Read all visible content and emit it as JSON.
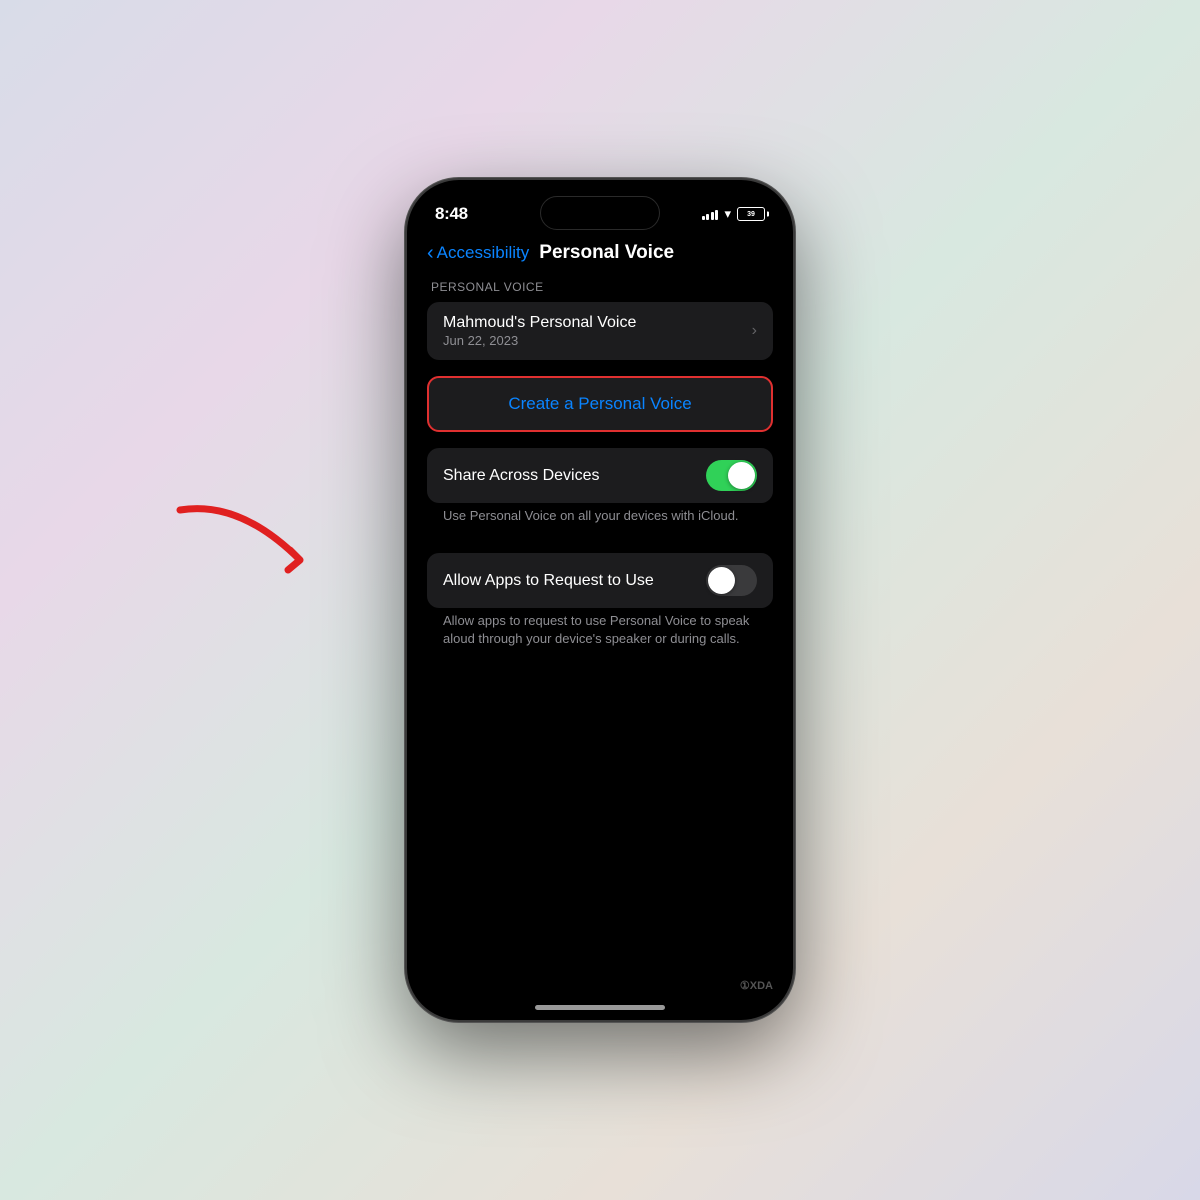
{
  "background": {
    "gradient": "linear-gradient(135deg, #d8dce8, #e8d8e8, #d8e8e0, #e8e0d8, #d8d8e8)"
  },
  "statusBar": {
    "time": "8:48",
    "battery": "39"
  },
  "navigation": {
    "backLabel": "Accessibility",
    "pageTitle": "Personal Voice"
  },
  "sections": {
    "personalVoiceLabel": "PERSONAL VOICE",
    "voiceEntry": {
      "name": "Mahmoud's Personal Voice",
      "date": "Jun 22, 2023"
    },
    "createButton": "Create a Personal Voice",
    "shareAcrossDevices": {
      "label": "Share Across Devices",
      "description": "Use Personal Voice on all your devices with iCloud.",
      "enabled": true
    },
    "allowApps": {
      "label": "Allow Apps to Request to Use",
      "description": "Allow apps to request to use Personal Voice to speak aloud through your device's speaker or during calls.",
      "enabled": false
    }
  },
  "watermark": "①XDA"
}
